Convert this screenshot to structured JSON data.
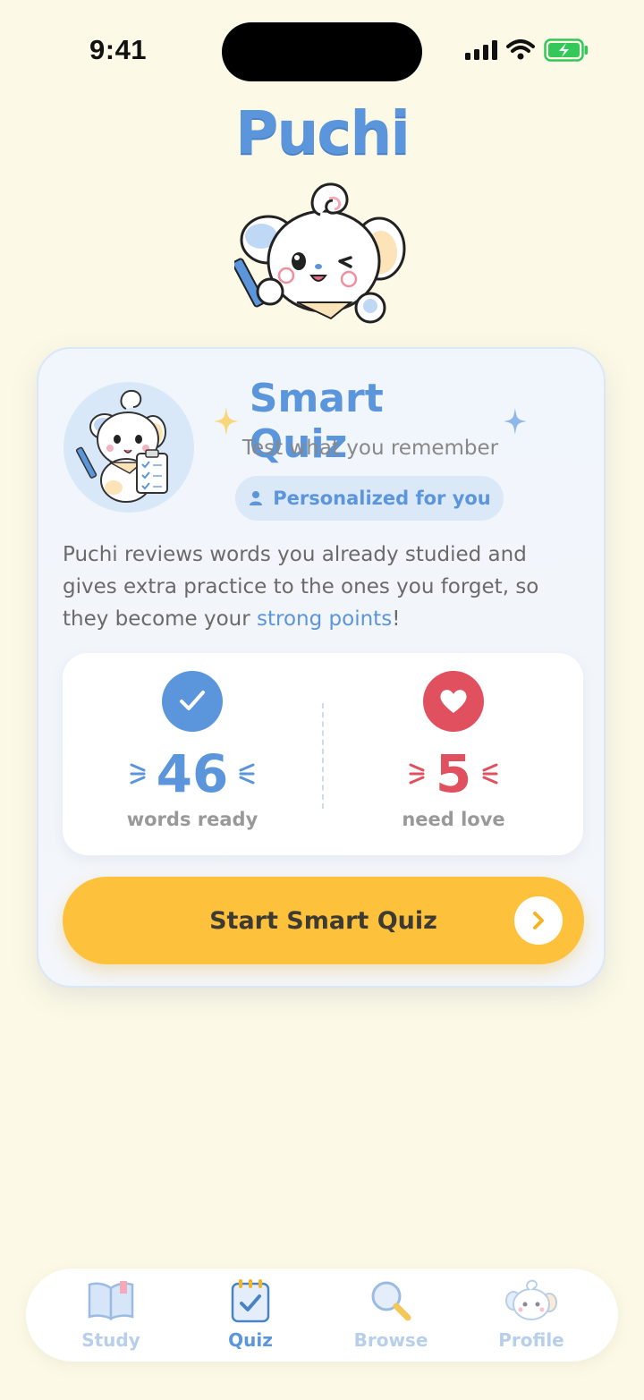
{
  "status_bar": {
    "time": "9:41"
  },
  "app": {
    "logo": "Puchi"
  },
  "quiz_card": {
    "title": "Smart Quiz",
    "subtitle": "Test what you remember",
    "badge": "Personalized for you",
    "description_part1": "Puchi reviews words you already studied and gives extra practice to the ones you forget, so they become your ",
    "description_highlight": "strong points",
    "description_end": "!",
    "stats": [
      {
        "value": "46",
        "label": "words ready",
        "color": "#5B95DB",
        "icon": "checkmark-icon"
      },
      {
        "value": "5",
        "label": "need love",
        "color": "#E0505E",
        "icon": "heart-icon"
      }
    ],
    "cta_label": "Start Smart Quiz"
  },
  "tabbar": {
    "items": [
      {
        "label": "Study",
        "icon": "book-icon",
        "active": false
      },
      {
        "label": "Quiz",
        "icon": "quiz-clipboard-icon",
        "active": true
      },
      {
        "label": "Browse",
        "icon": "magnifier-icon",
        "active": false
      },
      {
        "label": "Profile",
        "icon": "puppy-avatar-icon",
        "active": false
      }
    ]
  },
  "colors": {
    "background": "#FCF9E6",
    "accent": "#5B95DB",
    "cta": "#FDC13C",
    "danger": "#E0505E"
  }
}
